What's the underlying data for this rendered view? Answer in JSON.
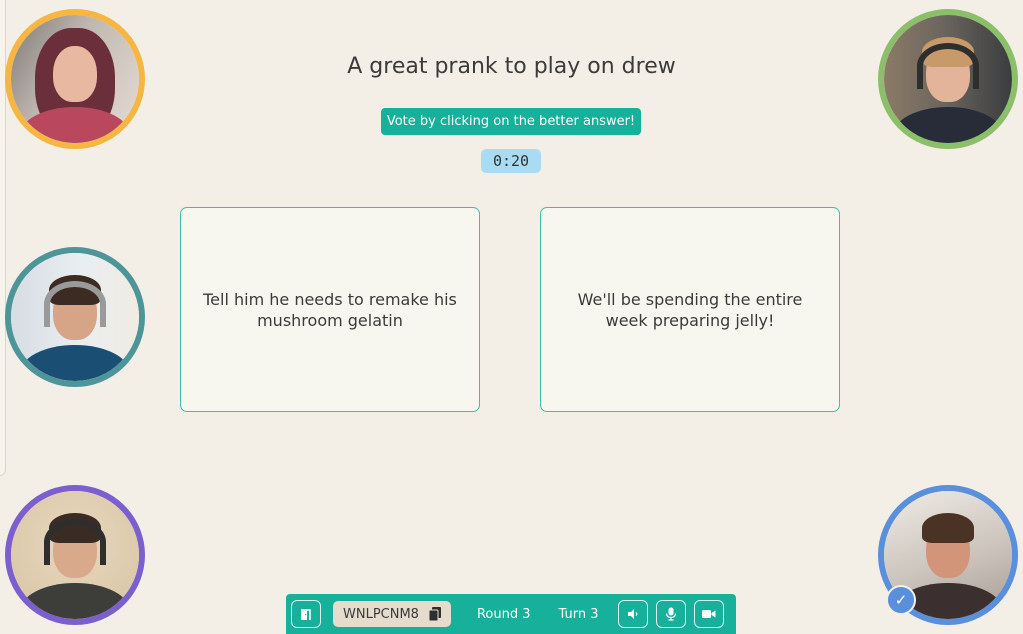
{
  "game": {
    "prompt": "A great prank to play on drew",
    "instruction": "Vote by clicking on the better answer!",
    "timer": "0:20",
    "answers": [
      {
        "text": "Tell him he needs to remake his mushroom gelatin"
      },
      {
        "text": "We'll be spending the entire week preparing jelly!"
      }
    ]
  },
  "players": [
    {
      "position": "top-left",
      "ring_color": "#f5b642",
      "voted": false
    },
    {
      "position": "top-right",
      "ring_color": "#8cbf6a",
      "voted": false
    },
    {
      "position": "middle-left",
      "ring_color": "#4e959a",
      "voted": false
    },
    {
      "position": "bottom-left",
      "ring_color": "#7b5fcf",
      "voted": false
    },
    {
      "position": "bottom-right",
      "ring_color": "#5a8fdb",
      "voted": true
    }
  ],
  "toolbar": {
    "room_code": "WNLPCNM8",
    "round_label": "Round 3",
    "turn_label": "Turn 3",
    "icons": {
      "exit": "door-exit-icon",
      "copy": "copy-icon",
      "speaker": "speaker-icon",
      "mic": "microphone-icon",
      "camera": "video-camera-icon"
    }
  },
  "colors": {
    "accent": "#16b09b",
    "background": "#f3efe6",
    "timer_bg": "#a9dcf3",
    "card_border": "#3cbfaf"
  },
  "badge": {
    "check": "✓"
  }
}
